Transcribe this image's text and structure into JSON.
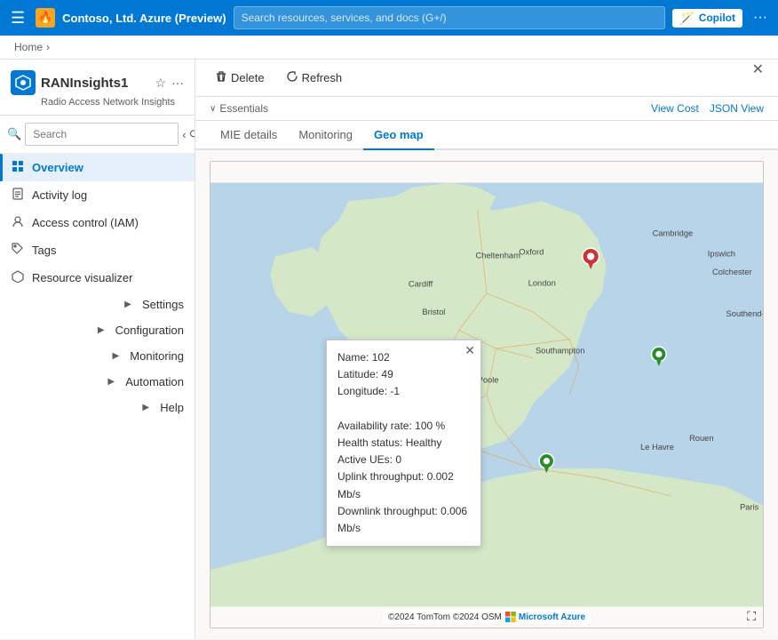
{
  "topnav": {
    "hamburger_icon": "☰",
    "brand": "Contoso, Ltd. Azure (Preview)",
    "badge_icon": "🔥",
    "search_placeholder": "Search resources, services, and docs (G+/)",
    "copilot_label": "Copilot",
    "more_icon": "···"
  },
  "breadcrumb": {
    "home": "Home",
    "separator": "›"
  },
  "resource": {
    "icon": "⬡",
    "name": "RANInsights1",
    "subtitle": "Radio Access Network Insights",
    "star_icon": "☆",
    "more_icon": "···",
    "close_icon": "✕"
  },
  "sidebar": {
    "search_placeholder": "Search",
    "search_icon": "🔍",
    "collapse_icon": "‹",
    "refresh_icon": "⟳",
    "items": [
      {
        "label": "Overview",
        "icon": "⊞",
        "active": true
      },
      {
        "label": "Activity log",
        "icon": "📋",
        "active": false
      },
      {
        "label": "Access control (IAM)",
        "icon": "👤",
        "active": false
      },
      {
        "label": "Tags",
        "icon": "🏷",
        "active": false
      },
      {
        "label": "Resource visualizer",
        "icon": "⬡",
        "active": false
      },
      {
        "label": "Settings",
        "icon": "▶",
        "active": false,
        "has_chevron": true
      },
      {
        "label": "Configuration",
        "icon": "▶",
        "active": false,
        "has_chevron": true
      },
      {
        "label": "Monitoring",
        "icon": "▶",
        "active": false,
        "has_chevron": true
      },
      {
        "label": "Automation",
        "icon": "▶",
        "active": false,
        "has_chevron": true
      },
      {
        "label": "Help",
        "icon": "▶",
        "active": false,
        "has_chevron": true
      }
    ]
  },
  "toolbar": {
    "delete_icon": "🗑",
    "delete_label": "Delete",
    "refresh_icon": "↻",
    "refresh_label": "Refresh"
  },
  "essentials": {
    "chevron_icon": "∨",
    "label": "Essentials",
    "view_cost_label": "View Cost",
    "json_view_label": "JSON View"
  },
  "tabs": [
    {
      "label": "MIE details",
      "active": false
    },
    {
      "label": "Monitoring",
      "active": false
    },
    {
      "label": "Geo map",
      "active": true
    }
  ],
  "popup": {
    "close_icon": "✕",
    "name_label": "Name:",
    "name_value": "102",
    "lat_label": "Latitude:",
    "lat_value": "49",
    "lon_label": "Longitude:",
    "lon_value": "-1",
    "avail_label": "Availability rate:",
    "avail_value": "100 %",
    "health_label": "Health status:",
    "health_value": "Healthy",
    "ue_label": "Active UEs:",
    "ue_value": "0",
    "uplink_label": "Uplink throughput:",
    "uplink_value": "0.002 Mb/s",
    "downlink_label": "Downlink throughput:",
    "downlink_value": "0.006 Mb/s"
  },
  "map_attribution": {
    "text": "©2024 TomTom  ©2024 OSM",
    "ms_logo": "⊞ Microsoft Azure",
    "camera_icon": "⛶"
  }
}
